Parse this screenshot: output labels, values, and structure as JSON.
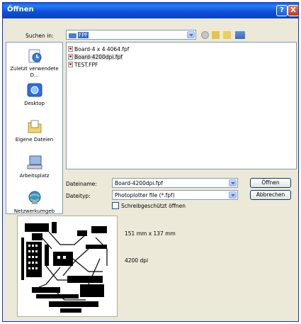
{
  "window": {
    "title": "Öffnen"
  },
  "titlebar": {
    "help_label": "?",
    "close_label": "X"
  },
  "lookin": {
    "label": "Suchen in:",
    "value": "FPF"
  },
  "places": [
    {
      "label": "Zuletzt verwendete D...",
      "icon": "recent-documents-icon"
    },
    {
      "label": "Desktop",
      "icon": "desktop-icon"
    },
    {
      "label": "Eigene Dateien",
      "icon": "my-documents-icon"
    },
    {
      "label": "Arbeitsplatz",
      "icon": "my-computer-icon"
    },
    {
      "label": "Netzwerkumgeb",
      "icon": "network-icon"
    }
  ],
  "files": [
    {
      "name": "Board-4 x 4 4064.fpf",
      "selected": false
    },
    {
      "name": "Board-4200dpi.fpf",
      "selected": true
    },
    {
      "name": "TEST.FPF",
      "selected": false
    }
  ],
  "filename": {
    "label": "Dateiname:",
    "value": "Board-4200dpi.fpf"
  },
  "filetype": {
    "label": "Dateityp:",
    "value": "Photoplotter file (*.fpf)"
  },
  "readonly": {
    "label": "Schreibgeschützt öffnen",
    "checked": false
  },
  "buttons": {
    "open": "Öffnen",
    "cancel": "Abbrechen"
  },
  "preview_info": {
    "size": "151 mm x 137 mm",
    "dpi": "4200 dpi"
  },
  "colors": {
    "title_bar": "#0a55dc",
    "dialog_bg": "#ece9d8",
    "selection": "#316ac5"
  }
}
